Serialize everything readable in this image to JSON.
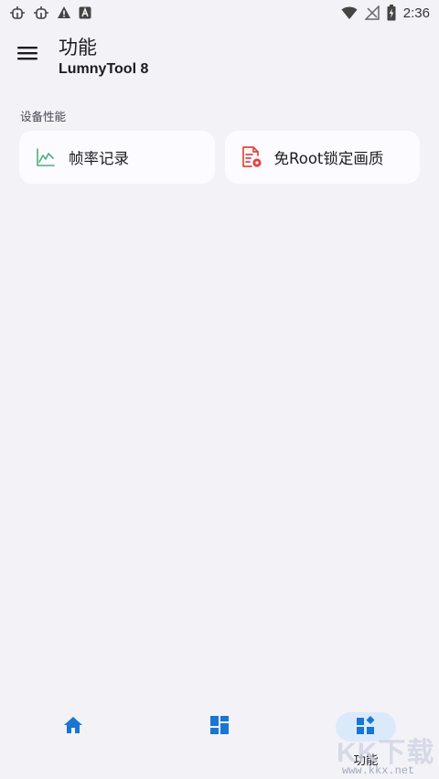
{
  "status_bar": {
    "time": "2:36",
    "left_icons": [
      "bug-icon",
      "bug-icon",
      "warning-icon",
      "a-notification-icon"
    ],
    "right_icons": [
      "wifi-icon",
      "no-signal-icon",
      "battery-charging-icon"
    ]
  },
  "header": {
    "title": "功能",
    "subtitle": "LumnyTool 8",
    "menu_icon": "menu-icon"
  },
  "section": {
    "label": "设备性能",
    "cards": [
      {
        "label": "帧率记录",
        "icon": "line-chart-icon",
        "icon_color": "#4caf79"
      },
      {
        "label": "免Root锁定画质",
        "icon": "document-settings-icon",
        "icon_color": "#e0473f"
      }
    ]
  },
  "bottom_nav": {
    "accent": "#1976d2",
    "items": [
      {
        "icon": "home-icon",
        "label": "",
        "active": false
      },
      {
        "icon": "dashboard-icon",
        "label": "",
        "active": false
      },
      {
        "icon": "widgets-icon",
        "label": "功能",
        "active": true
      }
    ]
  },
  "watermark": {
    "text": "KK下载",
    "url": "www.kkx.net"
  },
  "colors": {
    "background": "#f3f2f7",
    "card": "#fcfbff",
    "active_pill": "#dbeafb"
  }
}
